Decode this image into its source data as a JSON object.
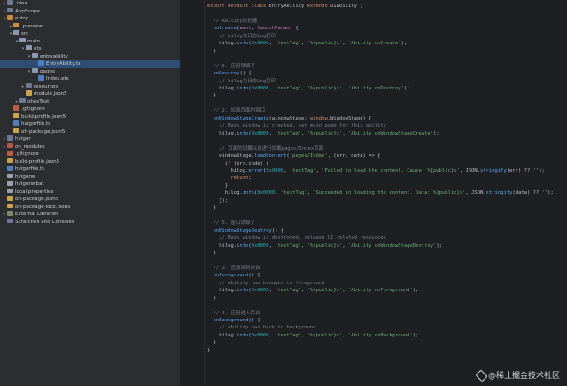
{
  "sidebar": {
    "items": [
      {
        "label": ".idea",
        "indent": 0,
        "arrow": "▸",
        "icon": "folder",
        "selected": false
      },
      {
        "label": "AppScope",
        "indent": 0,
        "arrow": "▸",
        "icon": "folder",
        "selected": false
      },
      {
        "label": "entry",
        "indent": 0,
        "arrow": "▾",
        "icon": "module-orange",
        "selected": false
      },
      {
        "label": ".preview",
        "indent": 1,
        "arrow": "▸",
        "icon": "module-orange",
        "selected": false
      },
      {
        "label": "src",
        "indent": 1,
        "arrow": "▾",
        "icon": "folder-open",
        "selected": false
      },
      {
        "label": "main",
        "indent": 2,
        "arrow": "▾",
        "icon": "folder-open",
        "selected": false
      },
      {
        "label": "ets",
        "indent": 3,
        "arrow": "▾",
        "icon": "folder-open",
        "selected": false
      },
      {
        "label": "entryability",
        "indent": 4,
        "arrow": "▾",
        "icon": "folder-open",
        "selected": false
      },
      {
        "label": "EntryAbility.ts",
        "indent": 5,
        "arrow": "",
        "icon": "file-ts",
        "selected": true
      },
      {
        "label": "pages",
        "indent": 4,
        "arrow": "▾",
        "icon": "folder-open",
        "selected": false
      },
      {
        "label": "Index.ets",
        "indent": 5,
        "arrow": "",
        "icon": "file-ts",
        "selected": false
      },
      {
        "label": "resources",
        "indent": 3,
        "arrow": "▸",
        "icon": "folder",
        "selected": false
      },
      {
        "label": "module.json5",
        "indent": 3,
        "arrow": "",
        "icon": "file-json",
        "selected": false
      },
      {
        "label": "ohosTest",
        "indent": 2,
        "arrow": "▸",
        "icon": "folder",
        "selected": false
      },
      {
        "label": ".gitignore",
        "indent": 1,
        "arrow": "",
        "icon": "file-git",
        "selected": false
      },
      {
        "label": "build-profile.json5",
        "indent": 1,
        "arrow": "",
        "icon": "file-json",
        "selected": false
      },
      {
        "label": "hvigorfile.ts",
        "indent": 1,
        "arrow": "",
        "icon": "file-ts",
        "selected": false
      },
      {
        "label": "oh-package.json5",
        "indent": 1,
        "arrow": "",
        "icon": "file-json",
        "selected": false
      },
      {
        "label": "hvigor",
        "indent": 0,
        "arrow": "▸",
        "icon": "folder",
        "selected": false
      },
      {
        "label": "oh_modules",
        "indent": 0,
        "arrow": "▸",
        "icon": "module-red",
        "selected": false
      },
      {
        "label": ".gitignore",
        "indent": 0,
        "arrow": "",
        "icon": "file-git",
        "selected": false
      },
      {
        "label": "build-profile.json5",
        "indent": 0,
        "arrow": "",
        "icon": "file-json",
        "selected": false
      },
      {
        "label": "hvigorfile.ts",
        "indent": 0,
        "arrow": "",
        "icon": "file-ts",
        "selected": false
      },
      {
        "label": "hvigorw",
        "indent": 0,
        "arrow": "",
        "icon": "file-txt",
        "selected": false
      },
      {
        "label": "hvigorw.bat",
        "indent": 0,
        "arrow": "",
        "icon": "file-txt",
        "selected": false
      },
      {
        "label": "local.properties",
        "indent": 0,
        "arrow": "",
        "icon": "file-txt",
        "selected": false
      },
      {
        "label": "oh-package.json5",
        "indent": 0,
        "arrow": "",
        "icon": "file-json",
        "selected": false
      },
      {
        "label": "oh-package-lock.json5",
        "indent": 0,
        "arrow": "",
        "icon": "file-json",
        "selected": false
      },
      {
        "label": "External Libraries",
        "indent": 0,
        "arrow": "▸",
        "icon": "lib",
        "selected": false
      },
      {
        "label": "Scratches and Consoles",
        "indent": 0,
        "arrow": "",
        "icon": "scratch",
        "selected": false
      }
    ]
  },
  "editor": {
    "lines": [
      [
        [
          "kw",
          "export default class "
        ],
        [
          "ty",
          "EntryAbility "
        ],
        [
          "kw",
          "extends "
        ],
        [
          "ty",
          "UIAbility {"
        ]
      ],
      [],
      [
        [
          "cm",
          "  // Ability的创建"
        ]
      ],
      [
        [
          "fn",
          "  onCreate"
        ],
        [
          "ty",
          "("
        ],
        [
          "prm",
          "want"
        ],
        [
          "ty",
          ", "
        ],
        [
          "prm",
          "launchParam"
        ],
        [
          "ty",
          ") {"
        ]
      ],
      [
        [
          "cm",
          "    // hilog为日志Log打印"
        ]
      ],
      [
        [
          "ty",
          "    hilog."
        ],
        [
          "fn",
          "info"
        ],
        [
          "ty",
          "("
        ],
        [
          "num",
          "0x0000"
        ],
        [
          "ty",
          ", "
        ],
        [
          "str",
          "'testTag'"
        ],
        [
          "ty",
          ", "
        ],
        [
          "str",
          "'%{public}s'"
        ],
        [
          "ty",
          ", "
        ],
        [
          "str",
          "'Ability onCreate'"
        ],
        [
          "ty",
          ");"
        ]
      ],
      [
        [
          "ty",
          "  }"
        ]
      ],
      [],
      [
        [
          "cm",
          "  // 6. 应用销毁了"
        ]
      ],
      [
        [
          "fn",
          "  onDestroy"
        ],
        [
          "ty",
          "() {"
        ]
      ],
      [
        [
          "cm",
          "    // hilog为日志Log打印"
        ]
      ],
      [
        [
          "ty",
          "    hilog."
        ],
        [
          "fn",
          "info"
        ],
        [
          "ty",
          "("
        ],
        [
          "num",
          "0x0000"
        ],
        [
          "ty",
          ", "
        ],
        [
          "str",
          "'testTag'"
        ],
        [
          "ty",
          ", "
        ],
        [
          "str",
          "'%{public}s'"
        ],
        [
          "ty",
          ", "
        ],
        [
          "str",
          "'Ability onDestroy'"
        ],
        [
          "ty",
          ");"
        ]
      ],
      [
        [
          "ty",
          "  }"
        ]
      ],
      [],
      [
        [
          "cm",
          "  // 2. 加载页面的窗口"
        ]
      ],
      [
        [
          "fn",
          "  onWindowStageCreate"
        ],
        [
          "ty",
          "(windowStage: "
        ],
        [
          "kw",
          "window"
        ],
        [
          "ty",
          ".WindowStage) {"
        ]
      ],
      [
        [
          "cm",
          "    // Main window is created, set main page for this ability"
        ]
      ],
      [
        [
          "ty",
          "    hilog."
        ],
        [
          "fn",
          "info"
        ],
        [
          "ty",
          "("
        ],
        [
          "num",
          "0x0000"
        ],
        [
          "ty",
          ", "
        ],
        [
          "str",
          "'testTag'"
        ],
        [
          "ty",
          ", "
        ],
        [
          "str",
          "'%{public}s'"
        ],
        [
          "ty",
          ", "
        ],
        [
          "str",
          "'Ability onWindowStageCreate'"
        ],
        [
          "ty",
          ");"
        ]
      ],
      [],
      [
        [
          "cm",
          "    // 页面的加载以及进行加载pages/Index页面"
        ]
      ],
      [
        [
          "ty",
          "    windowStage."
        ],
        [
          "fn",
          "loadContent"
        ],
        [
          "ty",
          "("
        ],
        [
          "str",
          "'pages/Index'"
        ],
        [
          "ty",
          ", (err, data) => {"
        ]
      ],
      [
        [
          "kw",
          "      if "
        ],
        [
          "ty",
          "(err.code) {"
        ]
      ],
      [
        [
          "ty",
          "        hilog."
        ],
        [
          "fn",
          "error"
        ],
        [
          "ty",
          "("
        ],
        [
          "num",
          "0x0000"
        ],
        [
          "ty",
          ", "
        ],
        [
          "str",
          "'testTag'"
        ],
        [
          "ty",
          ", "
        ],
        [
          "str",
          "'Failed to load the content. Cause: %{public}s'"
        ],
        [
          "ty",
          ", JSON."
        ],
        [
          "fn",
          "stringify"
        ],
        [
          "ty",
          "(err) ?? '');"
        ]
      ],
      [
        [
          "kw",
          "        return"
        ],
        [
          "ty",
          ";"
        ]
      ],
      [
        [
          "ty",
          "      }"
        ]
      ],
      [
        [
          "ty",
          "      hilog."
        ],
        [
          "fn",
          "info"
        ],
        [
          "ty",
          "("
        ],
        [
          "num",
          "0x0000"
        ],
        [
          "ty",
          ", "
        ],
        [
          "str",
          "'testTag'"
        ],
        [
          "ty",
          ", "
        ],
        [
          "str",
          "'Succeeded in loading the content. Data: %{public}s'"
        ],
        [
          "ty",
          ", JSON."
        ],
        [
          "fn",
          "stringify"
        ],
        [
          "ty",
          "(data) ?? '');"
        ]
      ],
      [
        [
          "ty",
          "    });"
        ]
      ],
      [
        [
          "ty",
          "  }"
        ]
      ],
      [],
      [
        [
          "cm",
          "  // 5. 窗口销毁了"
        ]
      ],
      [
        [
          "fn",
          "  onWindowStageDestroy"
        ],
        [
          "ty",
          "() {"
        ]
      ],
      [
        [
          "cm",
          "    // Main window is destroyed, release UI related resources"
        ]
      ],
      [
        [
          "ty",
          "    hilog."
        ],
        [
          "fn",
          "info"
        ],
        [
          "ty",
          "("
        ],
        [
          "num",
          "0x0000"
        ],
        [
          "ty",
          ", "
        ],
        [
          "str",
          "'testTag'"
        ],
        [
          "ty",
          ", "
        ],
        [
          "str",
          "'%{public}s'"
        ],
        [
          "ty",
          ", "
        ],
        [
          "str",
          "'Ability onWindowStageDestroy'"
        ],
        [
          "ty",
          ");"
        ]
      ],
      [
        [
          "ty",
          "  }"
        ]
      ],
      [],
      [
        [
          "cm",
          "  // 3. 应用換到前台"
        ]
      ],
      [
        [
          "fn",
          "  onForeground"
        ],
        [
          "ty",
          "() {"
        ]
      ],
      [
        [
          "cm",
          "    // Ability has brought to foreground"
        ]
      ],
      [
        [
          "ty",
          "    hilog."
        ],
        [
          "fn",
          "info"
        ],
        [
          "ty",
          "("
        ],
        [
          "num",
          "0x0000"
        ],
        [
          "ty",
          ", "
        ],
        [
          "str",
          "'testTag'"
        ],
        [
          "ty",
          ", "
        ],
        [
          "str",
          "'%{public}s'"
        ],
        [
          "ty",
          ", "
        ],
        [
          "str",
          "'Ability onForeground'"
        ],
        [
          "ty",
          ");"
        ]
      ],
      [
        [
          "ty",
          "  }"
        ]
      ],
      [],
      [
        [
          "cm",
          "  // 4. 应用进入后台"
        ]
      ],
      [
        [
          "fn",
          "  onBackground"
        ],
        [
          "ty",
          "() {"
        ]
      ],
      [
        [
          "cm",
          "    // Ability has back to background"
        ]
      ],
      [
        [
          "ty",
          "    hilog."
        ],
        [
          "fn",
          "info"
        ],
        [
          "ty",
          "("
        ],
        [
          "num",
          "0x0000"
        ],
        [
          "ty",
          ", "
        ],
        [
          "str",
          "'testTag'"
        ],
        [
          "ty",
          ", "
        ],
        [
          "str",
          "'%{public}s'"
        ],
        [
          "ty",
          ", "
        ],
        [
          "str",
          "'Ability onBackground'"
        ],
        [
          "ty",
          ");"
        ]
      ],
      [
        [
          "ty",
          "  }"
        ]
      ],
      [
        [
          "ty",
          "}"
        ]
      ]
    ]
  },
  "watermark": {
    "text": "@稀土掘金技术社区"
  }
}
